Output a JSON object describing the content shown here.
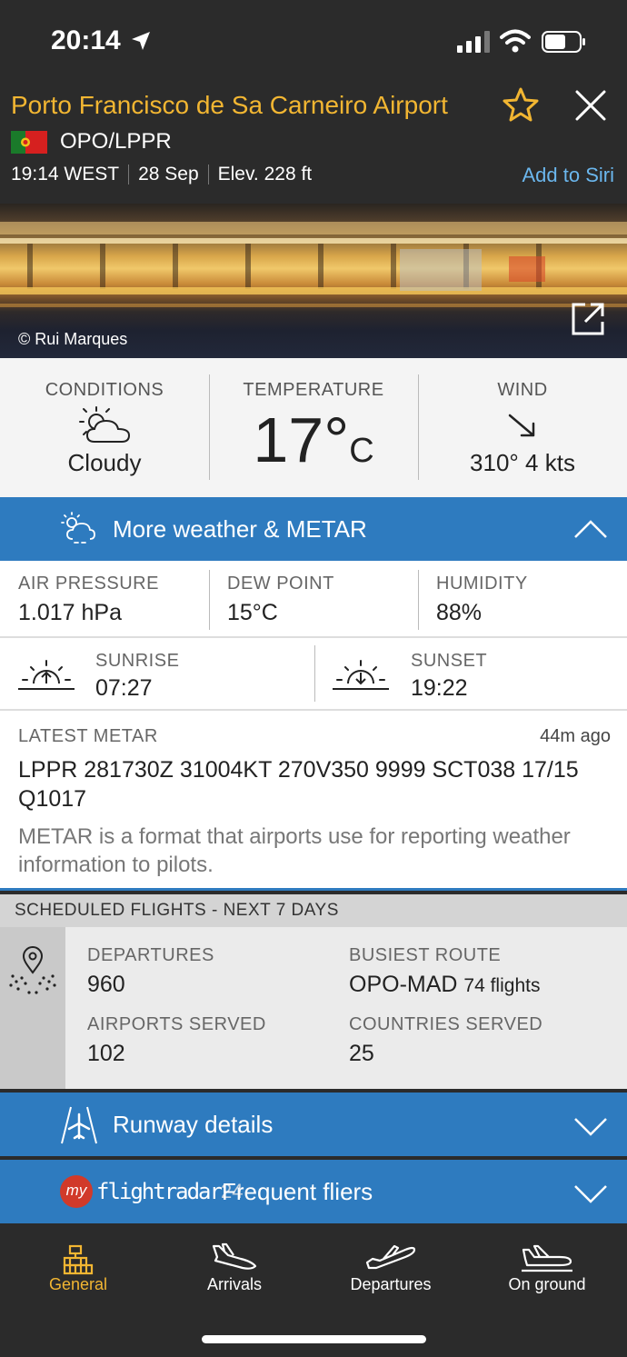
{
  "status_bar": {
    "time": "20:14"
  },
  "header": {
    "airport_name": "Porto Francisco de Sa Carneiro Airport",
    "code": "OPO/LPPR",
    "local_time": "19:14 WEST",
    "date": "28 Sep",
    "elevation": "Elev. 228 ft",
    "siri": "Add to Siri"
  },
  "photo": {
    "credit": "© Rui Marques"
  },
  "conditions": {
    "conditions_label": "CONDITIONS",
    "conditions_value": "Cloudy",
    "temperature_label": "TEMPERATURE",
    "temperature_value": "17°",
    "temperature_unit": "C",
    "wind_label": "WIND",
    "wind_value": "310° 4 kts"
  },
  "weather_bar": {
    "label": "More weather & METAR"
  },
  "weather": {
    "pressure_label": "AIR PRESSURE",
    "pressure_value": "1.017 hPa",
    "dew_label": "DEW POINT",
    "dew_value": "15°C",
    "humidity_label": "HUMIDITY",
    "humidity_value": "88%",
    "sunrise_label": "SUNRISE",
    "sunrise_value": "07:27",
    "sunset_label": "SUNSET",
    "sunset_value": "19:22"
  },
  "metar": {
    "title": "LATEST METAR",
    "ago": "44m ago",
    "code": "LPPR 281730Z 31004KT 270V350 9999 SCT038 17/15 Q1017",
    "description": "METAR is a format that airports use for reporting weather information to pilots."
  },
  "scheduled": {
    "header": "SCHEDULED FLIGHTS - NEXT 7 DAYS",
    "departures_label": "DEPARTURES",
    "departures_value": "960",
    "route_label": "BUSIEST ROUTE",
    "route_value": "OPO-MAD",
    "route_flights": "74 flights",
    "airports_label": "AIRPORTS SERVED",
    "airports_value": "102",
    "countries_label": "COUNTRIES SERVED",
    "countries_value": "25"
  },
  "runway_bar": {
    "label": "Runway details"
  },
  "fliers_bar": {
    "logo_my": "my",
    "logo_text": "flightradar",
    "logo_num": "24",
    "label": "Frequent fliers"
  },
  "tabs": [
    {
      "label": "General"
    },
    {
      "label": "Arrivals"
    },
    {
      "label": "Departures"
    },
    {
      "label": "On ground"
    }
  ],
  "colors": {
    "accent": "#f2b632",
    "blue": "#2e7bbf",
    "header_bg": "#2b2b2b",
    "link": "#6bb7ee"
  }
}
